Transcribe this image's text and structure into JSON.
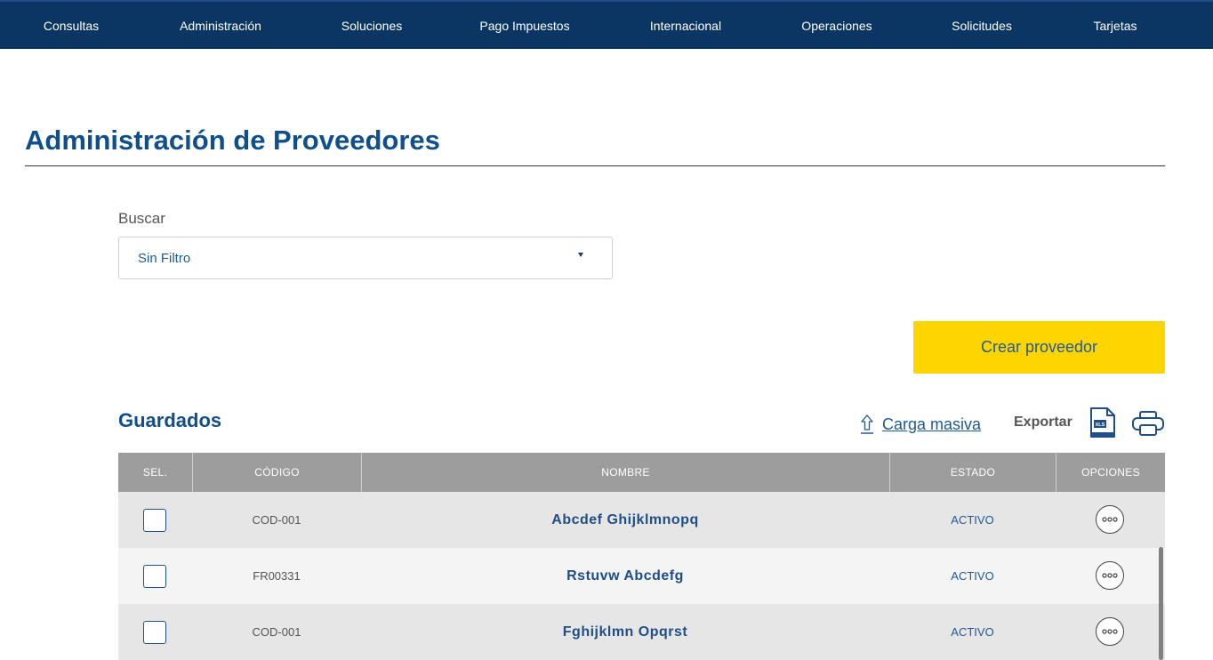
{
  "nav": {
    "items": [
      "Consultas",
      "Administración",
      "Soluciones",
      "Pago Impuestos",
      "Internacional",
      "Operaciones",
      "Solicitudes",
      "Tarjetas"
    ]
  },
  "page": {
    "title": "Administración de Proveedores"
  },
  "search": {
    "label": "Buscar",
    "selected": "Sin Filtro"
  },
  "actions": {
    "create_label": "Crear proveedor"
  },
  "saved": {
    "title": "Guardados",
    "upload_label": "Carga masiva",
    "export_label": "Exportar",
    "xls_badge": "XLS"
  },
  "table": {
    "headers": [
      "SEL.",
      "CÓDIGO",
      "NOMBRE",
      "ESTADO",
      "OPCIONES"
    ],
    "rows": [
      {
        "code": "COD-001",
        "name": "Abcdef  Ghijklmnopq",
        "state": "ACTIVO"
      },
      {
        "code": "FR00331",
        "name": "Rstuvw  Abcdefg",
        "state": "ACTIVO"
      },
      {
        "code": "COD-001",
        "name": "Fghijklmn  Opqrst",
        "state": "ACTIVO"
      }
    ]
  },
  "colors": {
    "nav_bg": "#0b3563",
    "brand_blue": "#0f4f8b",
    "button_yellow": "#ffd500",
    "table_header": "#9d9d9d"
  },
  "icons": [
    "upload-icon",
    "xls-file-icon",
    "printer-icon",
    "more-options-icon",
    "dropdown-caret-icon"
  ]
}
